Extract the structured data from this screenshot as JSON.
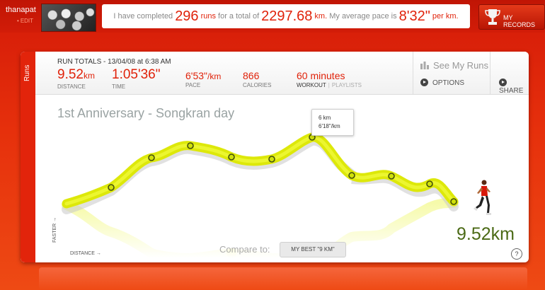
{
  "topbar": {
    "username": "thanapat",
    "edit_label": "EDIT",
    "summary": {
      "prefix": "I have completed",
      "runs_value": "296",
      "runs_unit": "runs",
      "mid": "for a total of",
      "total_value": "2297.68",
      "total_unit": "km.",
      "pace_prefix": "My average pace is",
      "pace_value": "8'32\"",
      "pace_unit": "per km."
    },
    "records_label": "MY RECORDS",
    "records_icon": "trophy-icon"
  },
  "panel": {
    "side_tab_label": "Runs",
    "run_title": "RUN TOTALS - 13/04/08 at 6:38 AM",
    "stats": {
      "distance_value": "9.52",
      "distance_unit": "km",
      "distance_label": "DISTANCE",
      "time_value": "1:05'36\"",
      "time_label": "TIME",
      "pace_value": "6'53\"",
      "pace_unit": "/km",
      "pace_label": "PACE",
      "calories_value": "866",
      "calories_label": "CALORIES",
      "workout_value": "60 minutes",
      "workout_label": "WORKOUT",
      "playlists_label": "PLAYLISTS"
    },
    "see_my_runs_label": "See My Runs",
    "options_label": "OPTIONS",
    "share_label": "SHARE",
    "graph_title": "1st Anniversary - Songkran day",
    "tooltip": {
      "line1": "6 km",
      "line2": "6'18\"/km"
    },
    "faster_label": "FASTER →",
    "distance_axis_label": "DISTANCE →",
    "compare_label": "Compare to:",
    "compare_value": "MY BEST \"9 KM\"",
    "big_distance": "9.52km",
    "help_label": "?"
  },
  "colors": {
    "accent": "#e0220a",
    "route_line": "#e6f20e",
    "distance_green": "#4b6a16"
  }
}
